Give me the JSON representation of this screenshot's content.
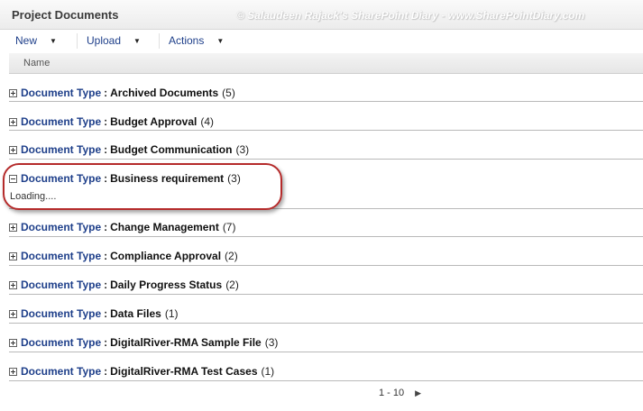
{
  "header": {
    "title": "Project Documents",
    "watermark": "© Salaudeen Rajack's SharePoint Diary - www.SharePointDiary.com"
  },
  "toolbar": {
    "new_label": "New",
    "upload_label": "Upload",
    "actions_label": "Actions"
  },
  "columns": {
    "name": "Name"
  },
  "groups": [
    {
      "key": "Document Type",
      "value": "Archived Documents",
      "count": "(5)"
    },
    {
      "key": "Document Type",
      "value": "Budget Approval",
      "count": "(4)"
    },
    {
      "key": "Document Type",
      "value": "Budget Communication",
      "count": "(3)"
    },
    {
      "key": "Document Type",
      "value": "Business requirement",
      "count": "(3)"
    },
    {
      "key": "Document Type",
      "value": "Change Management",
      "count": "(7)"
    },
    {
      "key": "Document Type",
      "value": "Compliance Approval",
      "count": "(2)"
    },
    {
      "key": "Document Type",
      "value": "Daily Progress Status",
      "count": "(2)"
    },
    {
      "key": "Document Type",
      "value": "Data Files",
      "count": "(1)"
    },
    {
      "key": "Document Type",
      "value": "DigitalRiver-RMA Sample File",
      "count": "(3)"
    },
    {
      "key": "Document Type",
      "value": "DigitalRiver-RMA Test Cases",
      "count": "(1)"
    }
  ],
  "expanded_group": {
    "loading_text": "Loading...."
  },
  "pager": {
    "range": "1 - 10"
  }
}
